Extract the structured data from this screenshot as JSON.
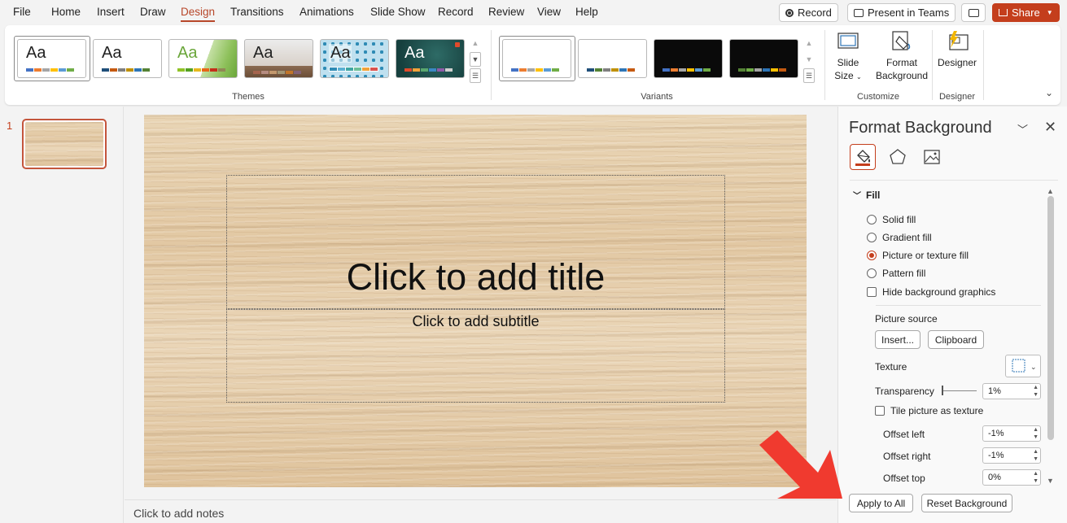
{
  "menu": {
    "tabs": [
      {
        "label": "File"
      },
      {
        "label": "Home"
      },
      {
        "label": "Insert"
      },
      {
        "label": "Draw"
      },
      {
        "label": "Design"
      },
      {
        "label": "Transitions"
      },
      {
        "label": "Animations"
      },
      {
        "label": "Slide Show"
      },
      {
        "label": "Record"
      },
      {
        "label": "Review"
      },
      {
        "label": "View"
      },
      {
        "label": "Help"
      }
    ],
    "active_tab": "Design",
    "record_button": "Record",
    "present_button": "Present in Teams",
    "share_button": "Share"
  },
  "ribbon": {
    "themes_label": "Themes",
    "variants_label": "Variants",
    "customize_label": "Customize",
    "designer_group_label": "Designer",
    "theme_sample_text": "Aa",
    "slide_size_label": "Slide",
    "slide_size_label2": "Size",
    "format_background_label": "Format",
    "format_background_label2": "Background",
    "designer_button_label": "Designer",
    "accent_color": "#b7472a"
  },
  "slides": {
    "selected_number": "1"
  },
  "slide": {
    "title_placeholder": "Click to add title",
    "subtitle_placeholder": "Click to add subtitle"
  },
  "notes": {
    "placeholder": "Click to add notes"
  },
  "format_pane": {
    "title": "Format Background",
    "section_fill": "Fill",
    "fill_options": [
      {
        "label": "Solid fill",
        "checked": false
      },
      {
        "label": "Gradient fill",
        "checked": false
      },
      {
        "label": "Picture or texture fill",
        "checked": true
      },
      {
        "label": "Pattern fill",
        "checked": false
      }
    ],
    "hide_background_graphics": "Hide background graphics",
    "picture_source_label": "Picture source",
    "insert_button": "Insert...",
    "clipboard_button": "Clipboard",
    "texture_label": "Texture",
    "transparency_label": "Transparency",
    "transparency_value": "1%",
    "tile_label": "Tile picture as texture",
    "offset_left_label": "Offset left",
    "offset_left_value": "-1%",
    "offset_right_label": "Offset right",
    "offset_right_value": "-1%",
    "offset_top_label": "Offset top",
    "offset_top_value": "0%",
    "apply_all_button": "Apply to All",
    "reset_button": "Reset Background"
  }
}
